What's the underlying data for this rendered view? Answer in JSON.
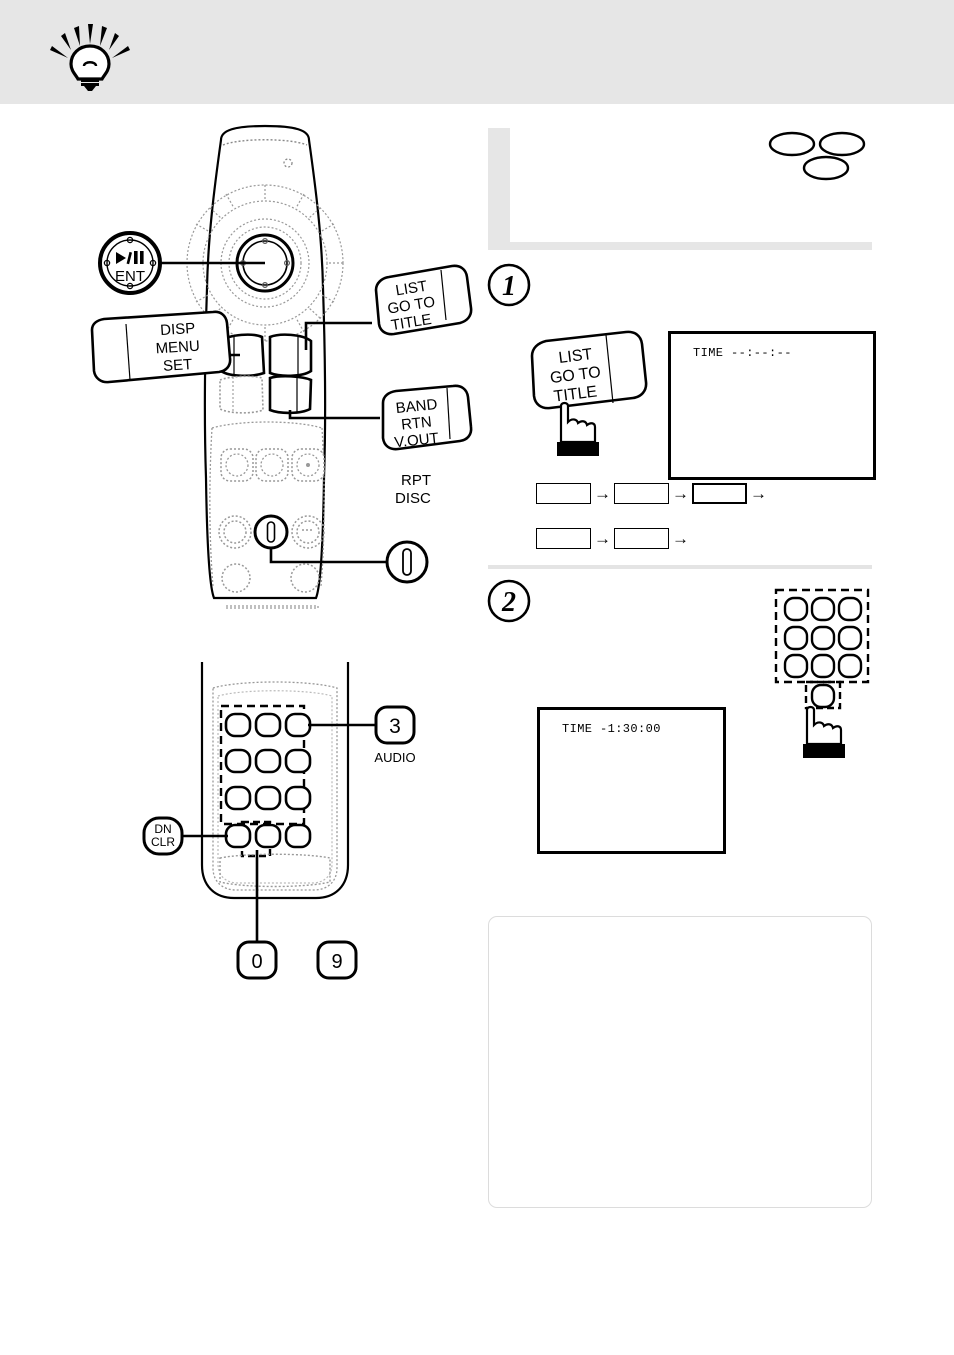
{
  "page": {
    "banner_icon": "lightbulb-icon",
    "background_color": "#ffffff",
    "banner_color": "#e6e6e6"
  },
  "header": {
    "title": "",
    "disc_badges": [
      "disc-ellipse-1",
      "disc-ellipse-2",
      "disc-ellipse-3"
    ]
  },
  "remote_upper": {
    "callouts": [
      {
        "id": "ent",
        "lines": [
          "▶/❙❙",
          "ENT"
        ],
        "shape": "circle"
      },
      {
        "id": "disp-menu-set",
        "lines": [
          "DISP",
          "MENU",
          "SET"
        ],
        "shape": "key-tag"
      },
      {
        "id": "list-goto-title",
        "lines": [
          "LIST",
          "GO TO",
          "TITLE"
        ],
        "shape": "key-tag"
      },
      {
        "id": "band-rtn-vout",
        "lines": [
          "BAND",
          "RTN",
          "V.OUT"
        ],
        "shape": "key-tag"
      },
      {
        "id": "rpt-disc",
        "lines": [
          "RPT",
          "DISC"
        ],
        "shape": "plain-label"
      }
    ]
  },
  "remote_lower": {
    "callouts": [
      {
        "id": "key-3-audio",
        "badge": "3",
        "sub": "AUDIO"
      },
      {
        "id": "key-dn-clr",
        "lines": [
          "DN",
          "CLR"
        ]
      },
      {
        "id": "key-0",
        "badge": "0"
      },
      {
        "id": "key-9",
        "badge": "9"
      }
    ]
  },
  "steps": [
    {
      "number": "1",
      "number_glyph": "①",
      "text": "",
      "key_label": [
        "LIST",
        "GO TO",
        "TITLE"
      ],
      "screen": {
        "line1": "TIME --:--:--"
      },
      "flow_rows": [
        {
          "boxes": [
            "",
            "",
            ""
          ],
          "arrow": "→",
          "highlight_index": 2
        },
        {
          "boxes": [
            "",
            ""
          ],
          "arrow": "→",
          "highlight_index": -1
        }
      ]
    },
    {
      "number": "2",
      "number_glyph": "②",
      "text": "",
      "screen": {
        "line1": "TIME -1:30:00"
      },
      "keypad": {
        "rows": 3,
        "cols": 3,
        "extra_key": true
      }
    }
  ],
  "note": {
    "text": ""
  }
}
